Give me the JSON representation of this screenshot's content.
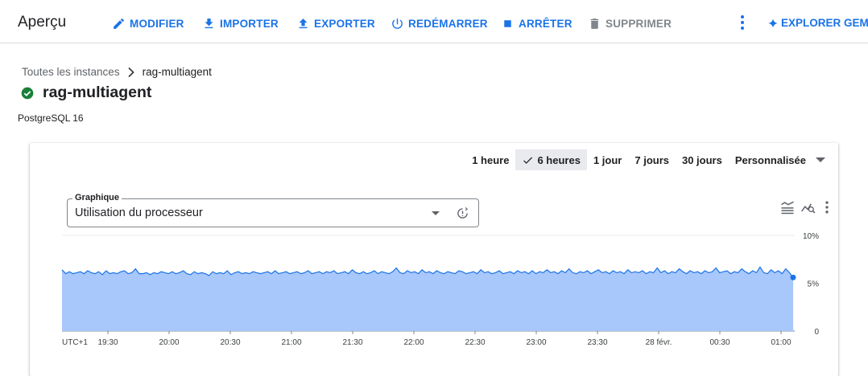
{
  "toolbar": {
    "title": "Aperçu",
    "buttons": [
      {
        "label": "MODIFIER",
        "icon": "pencil-icon",
        "enabled": true
      },
      {
        "label": "IMPORTER",
        "icon": "download-icon",
        "enabled": true
      },
      {
        "label": "EXPORTER",
        "icon": "upload-icon",
        "enabled": true
      },
      {
        "label": "REDÉMARRER",
        "icon": "power-icon",
        "enabled": true
      },
      {
        "label": "ARRÊTER",
        "icon": "stop-icon",
        "enabled": true
      },
      {
        "label": "SUPPRIMER",
        "icon": "trash-icon",
        "enabled": false
      }
    ],
    "more_icon": "kebab-menu-icon",
    "gemini_label": "EXPLORER GEMINI"
  },
  "breadcrumb": {
    "parent": "Toutes les instances",
    "current": "rag-multiagent"
  },
  "instance": {
    "name": "rag-multiagent",
    "status_icon": "check-circle-icon",
    "status_color": "#188038",
    "engine": "PostgreSQL 16"
  },
  "time_range": {
    "options": [
      "1 heure",
      "6 heures",
      "1 jour",
      "7 jours",
      "30 jours",
      "Personnalisée"
    ],
    "selected": "6 heures"
  },
  "chart_select": {
    "legend": "Graphique",
    "value": "Utilisation du processeur"
  },
  "chart_data": {
    "type": "area",
    "title": "",
    "xlabel": "",
    "ylabel": "",
    "ylim": [
      0,
      10
    ],
    "y_ticks": [
      "0",
      "5%",
      "10%"
    ],
    "y_tick_values": [
      0,
      5,
      10
    ],
    "timezone_label": "UTC+1",
    "x_ticks": [
      "19:30",
      "20:00",
      "20:30",
      "21:00",
      "21:30",
      "22:00",
      "22:30",
      "23:00",
      "23:30",
      "28 févr.",
      "00:30",
      "01:00"
    ],
    "series": [
      {
        "values": [
          6.4,
          6.0,
          6.2,
          6.0,
          6.1,
          6.2,
          6.0,
          6.3,
          6.1,
          6.0,
          6.2,
          5.9,
          6.3,
          6.0,
          6.1,
          6.0,
          6.2,
          6.3,
          6.0,
          6.1,
          6.5,
          6.0,
          6.0,
          6.1,
          5.9,
          6.1,
          6.0,
          6.2,
          6.1,
          6.0,
          6.2,
          6.0,
          6.1,
          6.3,
          6.0,
          5.9,
          6.2,
          6.0,
          6.1,
          6.0,
          5.8,
          6.2,
          6.0,
          6.1,
          6.0,
          6.3,
          5.9,
          6.1,
          6.2,
          6.0,
          6.1,
          6.0,
          6.2,
          6.1,
          6.0,
          6.1,
          6.2,
          6.0,
          6.3,
          6.0,
          6.1,
          6.2,
          6.0,
          6.1,
          6.2,
          6.0,
          6.1,
          6.3,
          6.0,
          6.1,
          6.2,
          6.0,
          6.2,
          6.1,
          6.3,
          6.0,
          6.1,
          6.2,
          6.0,
          6.4,
          6.1,
          6.0,
          6.2,
          6.0,
          6.1,
          6.3,
          6.0,
          6.2,
          6.1,
          6.0,
          6.2,
          6.6,
          6.1,
          6.0,
          6.3,
          6.1,
          6.2,
          6.0,
          6.4,
          6.1,
          6.2,
          6.0,
          6.3,
          6.1,
          6.0,
          6.2,
          6.1,
          6.0,
          6.3,
          6.2,
          6.0,
          6.1,
          6.2,
          6.0,
          6.4,
          6.1,
          6.2,
          6.0,
          6.1,
          6.3,
          6.0,
          6.1,
          6.2,
          6.0,
          6.3,
          6.1,
          6.2,
          6.0,
          6.3,
          6.0,
          6.2,
          6.1,
          6.4,
          6.1,
          6.2,
          6.0,
          6.3,
          6.1,
          6.5,
          6.1,
          6.0,
          6.2,
          6.1,
          6.3,
          6.0,
          6.2,
          6.4,
          6.1,
          6.2,
          6.0,
          6.3,
          6.1,
          6.2,
          6.0,
          6.4,
          6.1,
          6.2,
          6.1,
          6.3,
          6.0,
          6.2,
          6.1,
          6.6,
          6.1,
          6.3,
          6.0,
          6.2,
          6.1,
          6.5,
          6.2,
          6.0,
          6.3,
          6.1,
          6.2,
          6.0,
          6.3,
          6.1,
          6.2,
          6.6,
          6.1,
          6.2,
          6.3,
          6.0,
          6.2,
          6.1,
          6.5,
          6.2,
          6.0,
          6.3,
          6.1,
          6.7,
          6.1,
          6.0,
          6.4,
          6.1,
          6.3,
          6.0,
          6.5,
          6.1,
          5.6
        ]
      }
    ],
    "grid": true,
    "line_color": "#1a73e8",
    "fill_color": "#a8c7fa"
  },
  "chart_tools": [
    {
      "icon": "legend-toggle-icon"
    },
    {
      "icon": "explore-chart-icon"
    },
    {
      "icon": "more-vert-icon"
    }
  ]
}
